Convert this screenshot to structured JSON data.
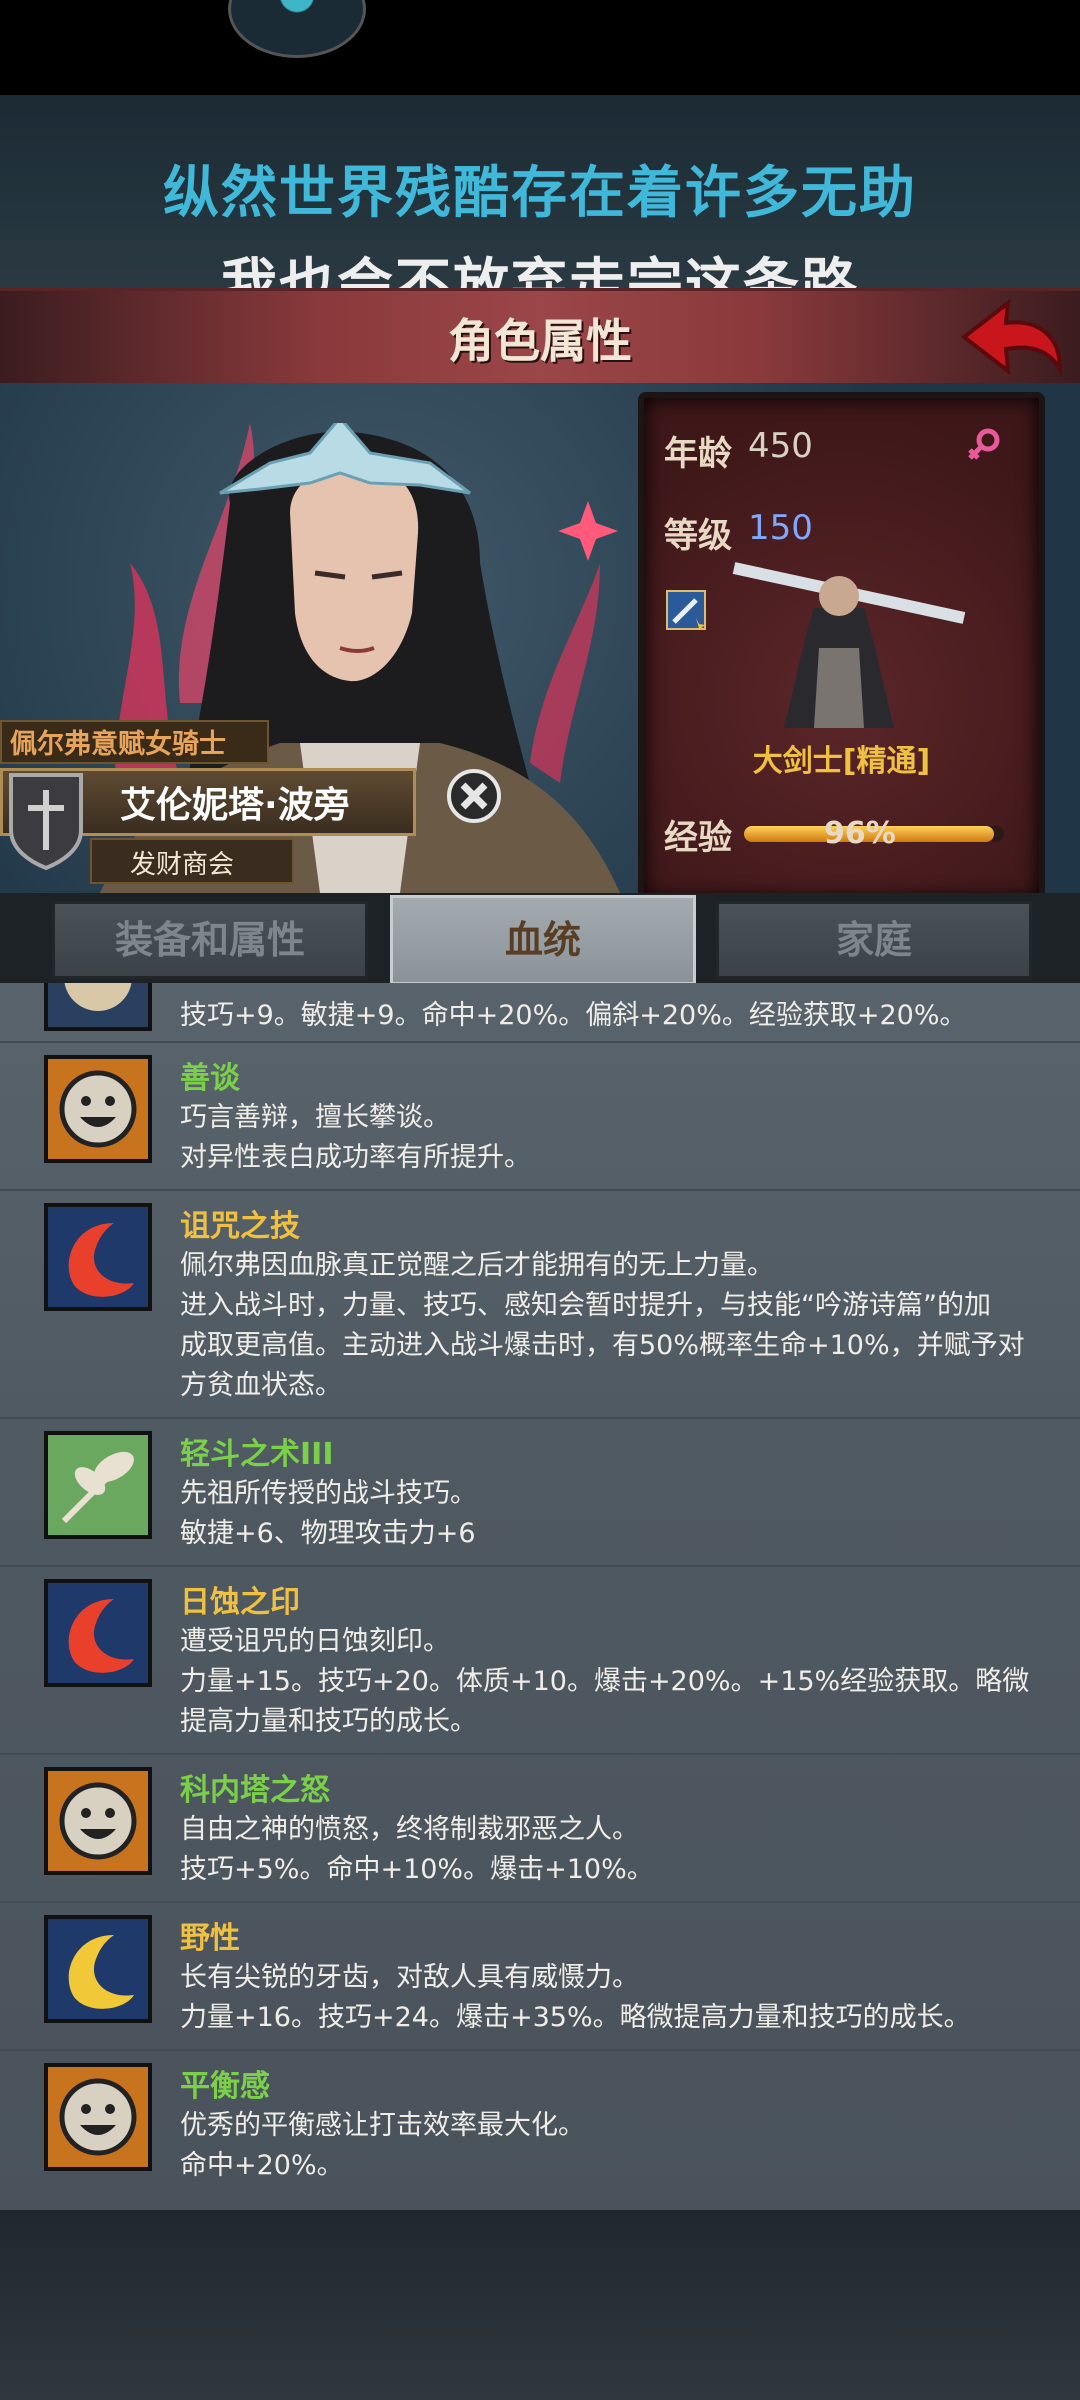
{
  "slogan": {
    "line1": "纵然世界残酷存在着许多无助",
    "line2": "我也会不放弃走完这条路"
  },
  "header": {
    "title": "角色属性"
  },
  "stats": {
    "age_label": "年龄",
    "age_value": "450",
    "level_label": "等级",
    "level_value": "150",
    "class_name": "大剑士[精通]",
    "exp_label": "经验",
    "exp_value": "96%",
    "exp_fraction": 0.96
  },
  "character": {
    "title": "佩尔弗意赋女骑士",
    "name": "艾伦妮塔·波旁",
    "guild": "发财商会"
  },
  "tabs": [
    {
      "label": "装备和属性",
      "active": false
    },
    {
      "label": "血统",
      "active": true
    },
    {
      "label": "家庭",
      "active": false
    }
  ],
  "traits": [
    {
      "name": "",
      "icon": "partial-icon",
      "lines": [
        "技巧+9。敏捷+9。命中+20%。偏斜+20%。经验获取+20%。"
      ]
    },
    {
      "name": "善谈",
      "name_color": "#7bd04a",
      "icon": "smiley-face-icon",
      "lines": [
        "巧言善辩，擅长攀谈。",
        "对异性表白成功率有所提升。"
      ]
    },
    {
      "name": "诅咒之技",
      "name_color": "#f0c040",
      "icon": "red-crescent-icon",
      "lines": [
        "佩尔弗因血脉真正觉醒之后才能拥有的无上力量。",
        "进入战斗时，力量、技巧、感知会暂时提升，与技能“吟游诗篇”的加",
        "成取更高值。主动进入战斗爆击时，有50%概率生命+10%，并赋予对",
        "方贫血状态。"
      ]
    },
    {
      "name": "轻斗之术III",
      "name_color": "#7bd04a",
      "icon": "leaf-icon",
      "lines": [
        "先祖所传授的战斗技巧。",
        "敏捷+6、物理攻击力+6"
      ]
    },
    {
      "name": "日蚀之印",
      "name_color": "#f0c040",
      "icon": "red-crescent-icon",
      "lines": [
        "遭受诅咒的日蚀刻印。",
        "力量+15。技巧+20。体质+10。爆击+20%。+15%经验获取。略微",
        "提高力量和技巧的成长。"
      ]
    },
    {
      "name": "科内塔之怒",
      "name_color": "#7bd04a",
      "icon": "smiley-face-icon",
      "lines": [
        "自由之神的愤怒，终将制裁邪恶之人。",
        "技巧+5%。命中+10%。爆击+10%。"
      ]
    },
    {
      "name": "野性",
      "name_color": "#f0c040",
      "icon": "yellow-crescent-icon",
      "lines": [
        "长有尖锐的牙齿，对敌人具有威慑力。",
        "力量+16。技巧+24。爆击+35%。略微提高力量和技巧的成长。"
      ]
    },
    {
      "name": "平衡感",
      "name_color": "#7bd04a",
      "icon": "smiley-face-icon",
      "lines": [
        "优秀的平衡感让打击效率最大化。",
        "命中+20%。"
      ]
    }
  ]
}
